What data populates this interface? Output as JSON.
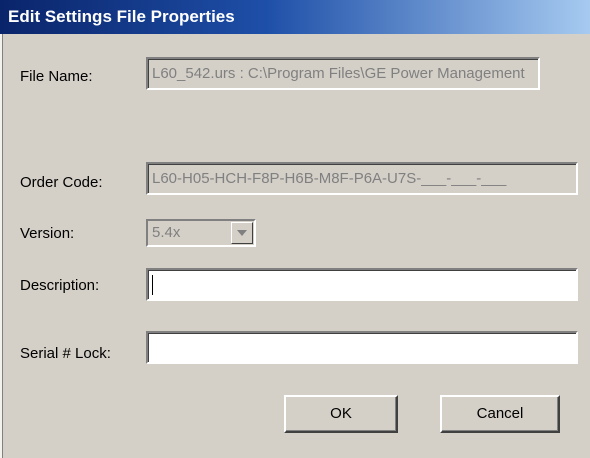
{
  "window": {
    "title": "Edit Settings File Properties"
  },
  "file_name": {
    "label": "File Name:",
    "value": "L60_542.urs : C:\\Program Files\\GE Power Management"
  },
  "order_code": {
    "label": "Order Code:",
    "value": "L60-H05-HCH-F8P-H6B-M8F-P6A-U7S-___-___-___"
  },
  "version": {
    "label": "Version:",
    "selected": "5.4x"
  },
  "description": {
    "label": "Description:",
    "value": ""
  },
  "serial_lock": {
    "label": "Serial # Lock:",
    "value": ""
  },
  "buttons": {
    "ok": "OK",
    "cancel": "Cancel"
  },
  "colors": {
    "title_gradient_start": "#0a246a",
    "title_gradient_end": "#a6caf0",
    "dialog_bg": "#d4d0c8",
    "disabled_text": "#808080"
  },
  "icons": {
    "version_dropdown": "chevron-down-icon"
  }
}
